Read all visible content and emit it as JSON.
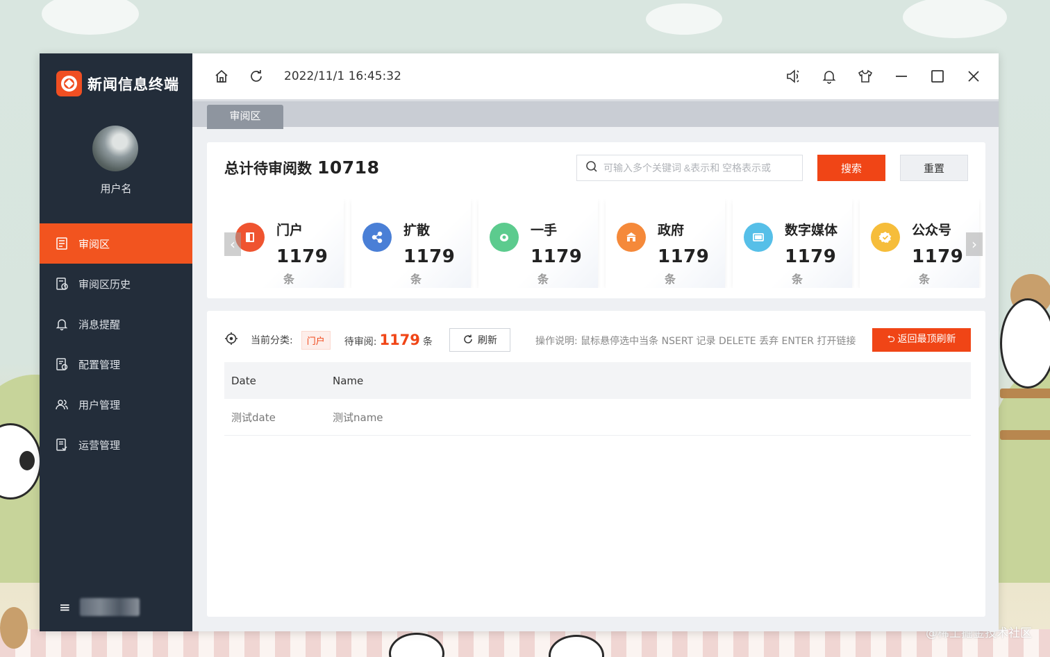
{
  "app": {
    "title": "新闻信息终端",
    "username": "用户名"
  },
  "topbar": {
    "datetime": "2022/11/1 16:45:32"
  },
  "sidebar": {
    "items": [
      {
        "label": "审阅区",
        "icon": "document-list-icon",
        "active": true
      },
      {
        "label": "审阅区历史",
        "icon": "history-doc-icon",
        "active": false
      },
      {
        "label": "消息提醒",
        "icon": "bell-icon",
        "active": false
      },
      {
        "label": "配置管理",
        "icon": "config-doc-icon",
        "active": false
      },
      {
        "label": "用户管理",
        "icon": "users-icon",
        "active": false
      },
      {
        "label": "运营管理",
        "icon": "operations-doc-icon",
        "active": false
      }
    ]
  },
  "tabs": [
    {
      "label": "审阅区"
    }
  ],
  "summary": {
    "title": "总计待审阅数",
    "total": "10718",
    "search_placeholder": "可输入多个关键词 &表示和 空格表示或",
    "search_button": "搜索",
    "reset_button": "重置"
  },
  "categories": [
    {
      "name": "门户",
      "count": "1179",
      "unit": "条",
      "color": "#ef5430",
      "icon": "portal-icon"
    },
    {
      "name": "扩散",
      "count": "1179",
      "unit": "条",
      "color": "#4a7fd6",
      "icon": "share-icon"
    },
    {
      "name": "一手",
      "count": "1179",
      "unit": "条",
      "color": "#5ccb8e",
      "icon": "hand-icon"
    },
    {
      "name": "政府",
      "count": "1179",
      "unit": "条",
      "color": "#f5893a",
      "icon": "government-icon"
    },
    {
      "name": "数字媒体",
      "count": "1179",
      "unit": "条",
      "color": "#56bfe8",
      "icon": "media-icon"
    },
    {
      "name": "公众号",
      "count": "1179",
      "unit": "条",
      "color": "#f6bd3a",
      "icon": "badge-check-icon"
    }
  ],
  "detail": {
    "current_category_label": "当前分类:",
    "current_category": "门户",
    "pending_label": "待审阅:",
    "pending_count": "1179",
    "pending_unit": "条",
    "refresh_button": "刷新",
    "help_text": "操作说明: 鼠标悬停选中当条 NSERT 记录 DELETE 丢弃 ENTER 打开链接",
    "back_button": "返回最顶刷新",
    "columns": [
      "Date",
      "Name"
    ],
    "rows": [
      [
        "测试date",
        "测试name"
      ]
    ]
  },
  "watermark": "@稀土掘金技术社区"
}
